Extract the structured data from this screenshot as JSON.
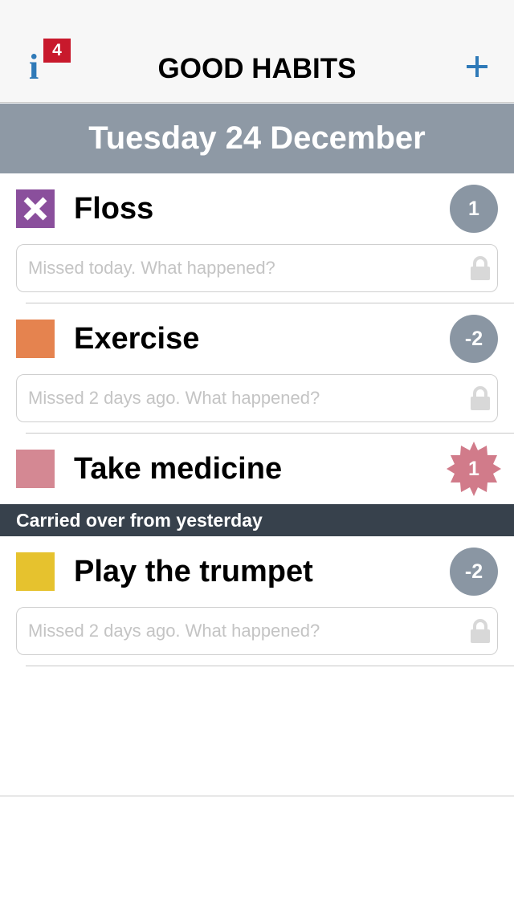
{
  "header": {
    "title": "GOOD HABITS",
    "info_badge": "4",
    "info_icon": "i",
    "add_icon": "plus-icon",
    "accent_color": "#2f7ab8",
    "badge_color": "#c8192c"
  },
  "date_banner": {
    "text": "Tuesday 24 December",
    "color": "#8e99a5"
  },
  "habits": [
    {
      "name": "Floss",
      "color": "#8a4f9c",
      "state": "missed-today",
      "streak": "1",
      "note_placeholder": "Missed today. What happened?"
    },
    {
      "name": "Exercise",
      "color": "#e5834f",
      "state": "pending",
      "streak": "-2",
      "note_placeholder": "Missed 2 days ago. What happened?"
    },
    {
      "name": "Take medicine",
      "color": "#d48893",
      "state": "pending",
      "streak": "1"
    }
  ],
  "carried_over": {
    "header": "Carried over from yesterday",
    "habits": [
      {
        "name": "Play the trumpet",
        "color": "#e6c22e",
        "state": "pending",
        "streak": "-2",
        "note_placeholder": "Missed 2 days ago. What happened?"
      }
    ]
  }
}
